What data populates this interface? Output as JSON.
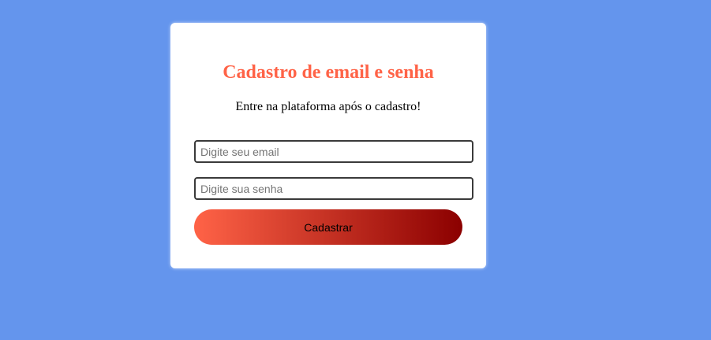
{
  "colors": {
    "background": "#6495ED",
    "card": "#FFFFFF",
    "title": "#FF6347",
    "button_gradient_start": "#FF6347",
    "button_gradient_end": "#8B0000"
  },
  "form": {
    "title": "Cadastro de email e senha",
    "subtitle": "Entre na plataforma após o cadastro!",
    "email": {
      "value": "",
      "placeholder": "Digite seu email"
    },
    "password": {
      "value": "",
      "placeholder": "Digite sua senha"
    },
    "submit_label": "Cadastrar"
  }
}
